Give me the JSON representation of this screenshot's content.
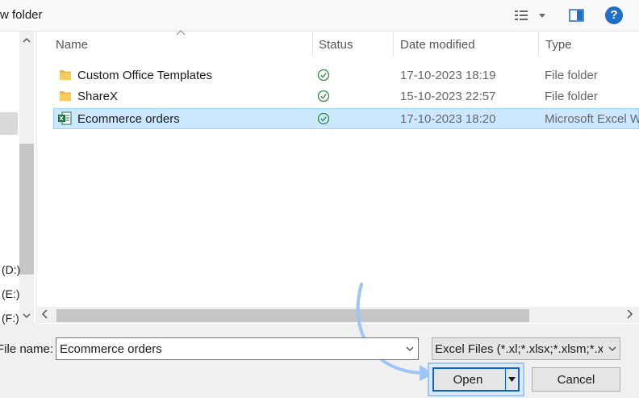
{
  "toolbar": {
    "new_folder_label": "w folder",
    "help_label": "?"
  },
  "nav": {
    "drives": [
      "(D:)",
      "(E:)",
      "(F:)"
    ]
  },
  "columns": {
    "name": "Name",
    "status": "Status",
    "date_modified": "Date modified",
    "type": "Type"
  },
  "files": [
    {
      "name": "Custom Office Templates",
      "date": "17-10-2023 18:19",
      "type": "File folder",
      "icon": "folder-icon",
      "status": "synced",
      "selected": false
    },
    {
      "name": "ShareX",
      "date": "15-10-2023 22:57",
      "type": "File folder",
      "icon": "folder-icon",
      "status": "synced",
      "selected": false
    },
    {
      "name": "Ecommerce orders",
      "date": "17-10-2023 18:20",
      "type": "Microsoft Excel W",
      "icon": "excel-file-icon",
      "status": "synced",
      "selected": true
    }
  ],
  "footer": {
    "file_name_label": "File name:",
    "file_name_value": "Ecommerce orders",
    "filter_value": "Excel Files (*.xl;*.xlsx;*.xlsm;*.xlsb",
    "open_label": "Open",
    "cancel_label": "Cancel"
  },
  "colors": {
    "accent": "#0b64c4",
    "selection": "#cce8ff",
    "annotation_arrow": "#9ec5f7",
    "sync_check": "#2e8b3e"
  }
}
